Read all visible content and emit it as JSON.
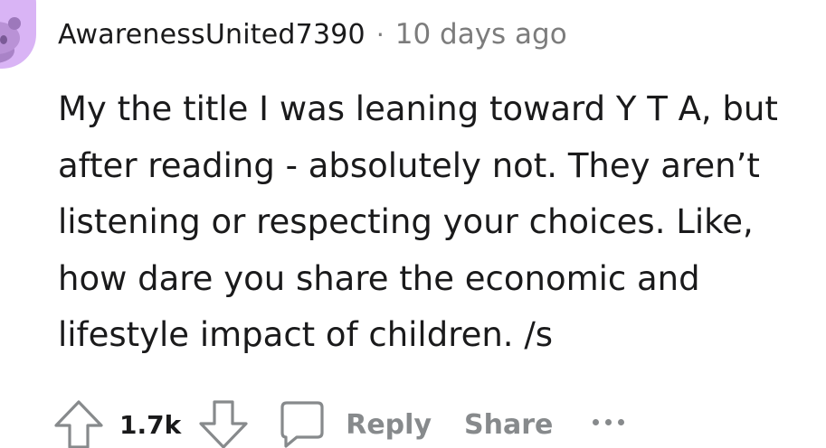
{
  "author": {
    "username": "AwarenessUnited7390",
    "separator": "·",
    "timestamp": "10 days ago",
    "avatar_icon": "snoo-avatar-icon",
    "avatar_color": "#d9b4f5"
  },
  "comment": {
    "body": "My the title I was leaning toward Y T A, but\nafter reading - absolutely not. They aren’t\nlistening or respecting your choices. Like,\nhow dare you share the economic and\nlifestyle impact of children. /s"
  },
  "actions": {
    "upvote_icon": "arrow-up-icon",
    "score": "1.7k",
    "downvote_icon": "arrow-down-icon",
    "reply_icon": "speech-bubble-icon",
    "reply_label": "Reply",
    "share_label": "Share",
    "more_icon": "ellipsis-icon"
  },
  "colors": {
    "text_primary": "#1a1a1b",
    "text_muted": "#7c7c7c",
    "icon_gray": "#878a8c"
  }
}
